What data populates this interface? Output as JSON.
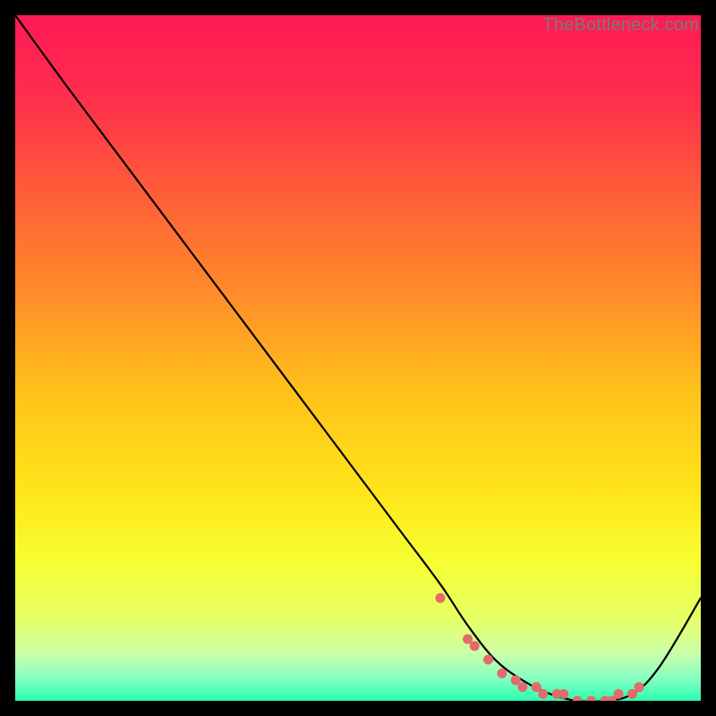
{
  "watermark": "TheBottleneck.com",
  "colors": {
    "gradient_stops": [
      {
        "offset": 0.0,
        "color": "#ff1a55"
      },
      {
        "offset": 0.12,
        "color": "#ff2e4c"
      },
      {
        "offset": 0.25,
        "color": "#ff5a3a"
      },
      {
        "offset": 0.4,
        "color": "#ff8a2a"
      },
      {
        "offset": 0.55,
        "color": "#ffc21a"
      },
      {
        "offset": 0.7,
        "color": "#ffe61a"
      },
      {
        "offset": 0.8,
        "color": "#f7ff33"
      },
      {
        "offset": 0.88,
        "color": "#e6ff66"
      },
      {
        "offset": 0.93,
        "color": "#ccffa6"
      },
      {
        "offset": 0.965,
        "color": "#8affc2"
      },
      {
        "offset": 1.0,
        "color": "#2bffb0"
      }
    ],
    "curve": "#000000",
    "dots": "#e26b6b"
  },
  "chart_data": {
    "type": "line",
    "title": "",
    "xlabel": "",
    "ylabel": "",
    "xlim": [
      0,
      100
    ],
    "ylim": [
      0,
      100
    ],
    "grid": false,
    "legend": false,
    "annotations": [
      "TheBottleneck.com"
    ],
    "series": [
      {
        "name": "bottleneck-curve",
        "x": [
          0,
          8,
          20,
          32,
          44,
          56,
          62,
          66,
          70,
          74,
          78,
          82,
          86,
          90,
          94,
          100
        ],
        "y": [
          100,
          89,
          73,
          57,
          41,
          25,
          17,
          11,
          6,
          3,
          1,
          0,
          0,
          1,
          5,
          15
        ]
      }
    ],
    "highlight_points": {
      "name": "optimal-range-dots",
      "x": [
        62,
        66,
        67,
        69,
        71,
        73,
        74,
        76,
        77,
        79,
        80,
        82,
        84,
        86,
        87,
        88,
        90,
        91
      ],
      "y": [
        15,
        9,
        8,
        6,
        4,
        3,
        2,
        2,
        1,
        1,
        1,
        0,
        0,
        0,
        0,
        1,
        1,
        2
      ]
    }
  }
}
